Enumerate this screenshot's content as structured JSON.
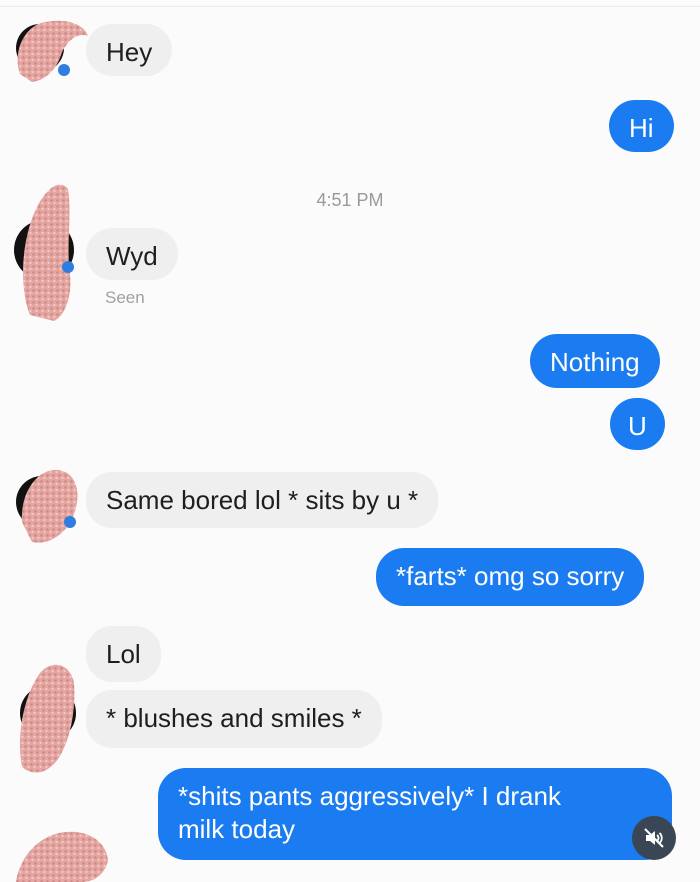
{
  "messages": [
    {
      "id": "m1",
      "side": "incoming",
      "text": "Hey"
    },
    {
      "id": "m2",
      "side": "outgoing",
      "text": "Hi"
    },
    {
      "id": "m3",
      "side": "incoming",
      "text": "Wyd"
    },
    {
      "id": "m4",
      "side": "outgoing",
      "text": "Nothing"
    },
    {
      "id": "m5",
      "side": "outgoing",
      "text": "U"
    },
    {
      "id": "m6",
      "side": "incoming",
      "text": "Same bored lol * sits by u *"
    },
    {
      "id": "m7",
      "side": "outgoing",
      "text": "*farts* omg so sorry"
    },
    {
      "id": "m8",
      "side": "incoming",
      "text": "Lol"
    },
    {
      "id": "m9",
      "side": "incoming",
      "text": "* blushes and smiles *"
    },
    {
      "id": "m10",
      "side": "outgoing",
      "text": "*shits pants aggressively* I drank milk today"
    }
  ],
  "timestamp": "4:51 PM",
  "seen_label": "Seen",
  "colors": {
    "outgoing_bubble": "#1a7cf0",
    "incoming_bubble": "#efefef",
    "avatar_blur": "#e6a9a4"
  },
  "icons": {
    "mute": "speaker-muted-icon",
    "avatar": "blurred-avatar-icon"
  }
}
